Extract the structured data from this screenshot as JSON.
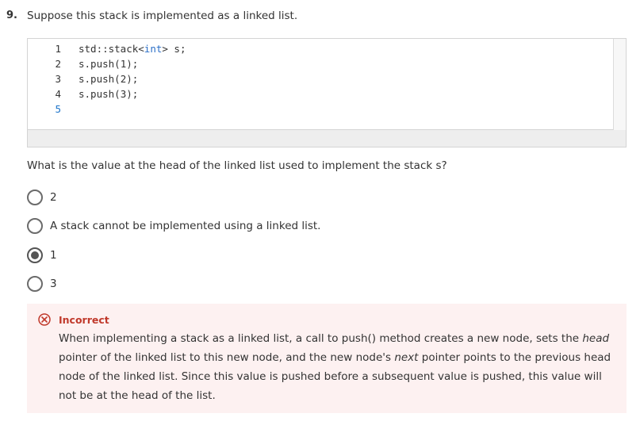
{
  "question": {
    "number": "9.",
    "title": "Suppose this stack is implemented as a linked list.",
    "prompt": "What is the value at the head of the linked list used to implement the stack s?"
  },
  "code": {
    "line_numbers": [
      "1",
      "2",
      "3",
      "4",
      "5"
    ],
    "lines": [
      {
        "prefix": "std::stack<",
        "keyword": "int",
        "suffix": "> s;"
      },
      {
        "prefix": "s.push(",
        "keyword": "",
        "suffix": "1);"
      },
      {
        "prefix": "s.push(",
        "keyword": "",
        "suffix": "2);"
      },
      {
        "prefix": "s.push(",
        "keyword": "",
        "suffix": "3);"
      },
      {
        "prefix": "",
        "keyword": "",
        "suffix": ""
      }
    ]
  },
  "options": [
    {
      "label": "2",
      "selected": false
    },
    {
      "label": "A stack cannot be implemented using a linked list.",
      "selected": false
    },
    {
      "label": "1",
      "selected": true
    },
    {
      "label": "3",
      "selected": false
    }
  ],
  "feedback": {
    "status": "Incorrect",
    "text_1": "When implementing a stack as a linked list, a call to push() method creates a new node, sets the ",
    "em_1": "head",
    "text_2": " pointer of the linked list to this new node, and the new node's ",
    "em_2": "next",
    "text_3": " pointer points to the previous head node of the linked list. Since this value is pushed before a subsequent value is pushed, this value will not be at the head of the list.",
    "color": "#c0392b",
    "background": "#fdf1f1"
  }
}
